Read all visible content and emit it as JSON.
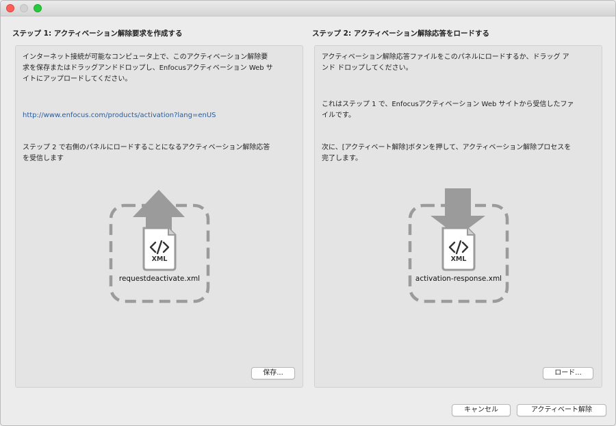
{
  "step1": {
    "heading": "ステップ 1: アクティベーション解除要求を作成する",
    "para1_line1": "インターネット接続が可能なコンピュータ上で、このアクティベーション解除要",
    "para1_line2": "求を保存またはドラッグアンドドロップし、Enfocusアクティベーション Web サ",
    "para1_line3": "イトにアップロードしてください。",
    "link": "http://www.enfocus.com/products/activation?lang=enUS",
    "para2_line1": "ステップ 2 で右側のパネルにロードすることになるアクティベーション解除応答",
    "para2_line2": "を受信します",
    "file_badge": "XML",
    "file_name": "requestdeactivate.xml",
    "save_button": "保存..."
  },
  "step2": {
    "heading": "ステップ 2: アクティベーション解除応答をロードする",
    "para1_line1": "アクティベーション解除応答ファイルをこのパネルにロードするか、ドラッグ ア",
    "para1_line2": "ンド ドロップしてください。",
    "para2_line1": "これはステップ 1 で、Enfocusアクティベーション Web サイトから受信したファ",
    "para2_line2": "イルです。",
    "para3_line1": "次に、[アクティベート解除]ボタンを押して、アクティベーション解除プロセスを",
    "para3_line2": "完了します。",
    "file_badge": "XML",
    "file_name": "activation-response.xml",
    "load_button": "ロード..."
  },
  "footer": {
    "cancel_button": "キャンセル",
    "deactivate_button": "アクティベート解除"
  },
  "colors": {
    "window_bg": "#ececec",
    "panel_bg": "#e4e4e4",
    "link": "#2b5c98",
    "icon_gray": "#9b9b9b",
    "close": "#fe5f57",
    "zoom": "#28c840"
  }
}
